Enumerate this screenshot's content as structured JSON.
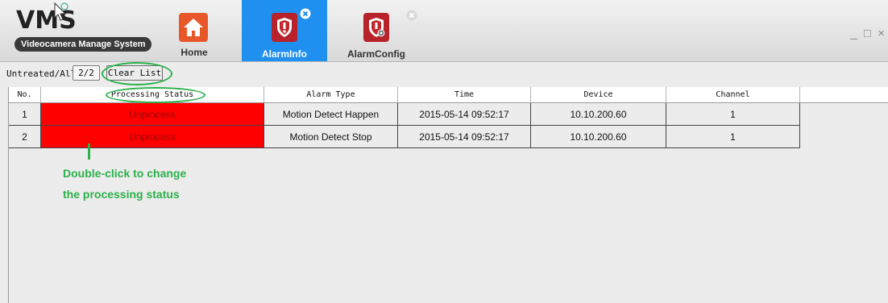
{
  "app": {
    "logo_title": "VMS",
    "logo_subtitle": "Videocamera Manage System"
  },
  "tabs": [
    {
      "label": "Home",
      "icon": "home-icon",
      "active": false
    },
    {
      "label": "AlarmInfo",
      "icon": "alarm-shield-icon",
      "active": true,
      "closable": true
    },
    {
      "label": "AlarmConfig",
      "icon": "alarm-config-shield-icon",
      "active": false,
      "closable": true
    }
  ],
  "window_controls": {
    "minimize": "_",
    "maximize": "□",
    "close": "×"
  },
  "toolbar": {
    "count_label": "Untreated/All",
    "count_value": "2/2",
    "clear_label": "Clear List"
  },
  "table": {
    "columns": [
      "No.",
      "Processing Status",
      "Alarm Type",
      "Time",
      "Device",
      "Channel"
    ],
    "rows": [
      {
        "no": "1",
        "status": "Unprocess",
        "type": "Motion Detect Happen",
        "time": "2015-05-14 09:52:17",
        "device": "10.10.200.60",
        "channel": "1"
      },
      {
        "no": "2",
        "status": "Unprocess",
        "type": "Motion Detect Stop",
        "time": "2015-05-14 09:52:17",
        "device": "10.10.200.60",
        "channel": "1"
      }
    ]
  },
  "annotation": {
    "line1": "Double-click to change",
    "line2": "the processing status"
  },
  "colors": {
    "active_tab": "#1f8ff0",
    "status_unprocess": "#ff0000",
    "annotation": "#2bb14a",
    "alarm_shield": "#c0282d"
  }
}
